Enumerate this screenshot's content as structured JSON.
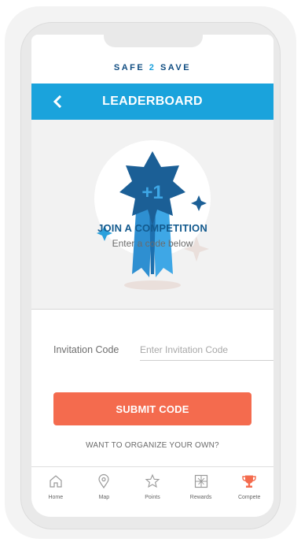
{
  "app": {
    "brand_left": "SAFE",
    "brand_num": "2",
    "brand_right": "SAVE"
  },
  "header": {
    "title": "LEADERBOARD",
    "back_icon": "chevron-left-icon",
    "background": "#1aa3dc"
  },
  "hero": {
    "badge_text": "+1",
    "title": "JOIN A COMPETITION",
    "subtitle": "Enter a code below"
  },
  "form": {
    "invitation_label": "Invitation Code",
    "invitation_placeholder": "Enter Invitation Code",
    "invitation_value": "",
    "submit_label": "SUBMIT CODE",
    "organize_link": "WANT TO ORGANIZE YOUR OWN?"
  },
  "tabbar": {
    "items": [
      {
        "label": "Home",
        "icon": "home-icon",
        "active": false
      },
      {
        "label": "Map",
        "icon": "map-pin-icon",
        "active": false
      },
      {
        "label": "Points",
        "icon": "star-icon",
        "active": false
      },
      {
        "label": "Rewards",
        "icon": "gift-icon",
        "active": false
      },
      {
        "label": "Compete",
        "icon": "trophy-icon",
        "active": true
      }
    ]
  },
  "colors": {
    "accent_blue": "#1aa3dc",
    "dark_blue": "#135a8e",
    "submit_orange": "#f46b4e",
    "active_tab": "#f46b4e"
  }
}
